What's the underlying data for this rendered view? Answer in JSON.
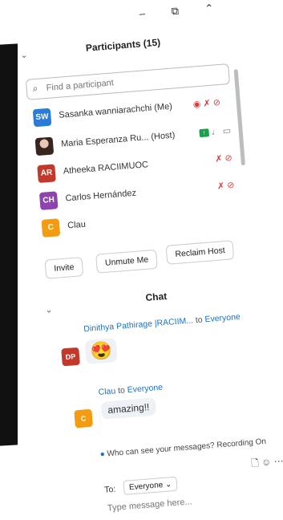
{
  "window": {
    "minimize": "–",
    "maximize": "⧉",
    "close": "⌃"
  },
  "participants": {
    "title": "Participants (15)",
    "search_placeholder": "Find a participant",
    "list": [
      {
        "initials": "SW",
        "name": "Sasanka wanniarachchi (Me)",
        "color": "#2b7bd8"
      },
      {
        "initials": "",
        "name": "Maria Esperanza Ru... (Host)",
        "color": "#3a2420"
      },
      {
        "initials": "AR",
        "name": "Atheeka RACIIMUOC",
        "color": "#c0392b"
      },
      {
        "initials": "CH",
        "name": "Carlos Hernández",
        "color": "#8e44ad"
      },
      {
        "initials": "C",
        "name": "Clau",
        "color": "#f39c12"
      }
    ],
    "buttons": {
      "invite": "Invite",
      "unmute": "Unmute Me",
      "reclaim": "Reclaim Host"
    }
  },
  "chat": {
    "title": "Chat",
    "messages": [
      {
        "avatar": "DP",
        "avatar_color": "#c0392b",
        "sender": "Dinithya Pathirage |RACIIM...",
        "to_word": "to",
        "recipient": "Everyone",
        "text": "😍"
      },
      {
        "avatar": "C",
        "avatar_color": "#f39c12",
        "sender": "Clau",
        "to_word": "to",
        "recipient": "Everyone",
        "text": "amazing!!"
      }
    ],
    "info": "Who can see your messages? Recording On",
    "to_label": "To:",
    "recipient_select": "Everyone ⌄",
    "input_placeholder": "Type message here..."
  },
  "icons": {
    "record": "◉",
    "mic_off": "🎙̸",
    "video_off": "⊘",
    "mic": "🎙",
    "video": "▭",
    "file": "🗋",
    "emoji": "☺",
    "more": "⋯"
  }
}
